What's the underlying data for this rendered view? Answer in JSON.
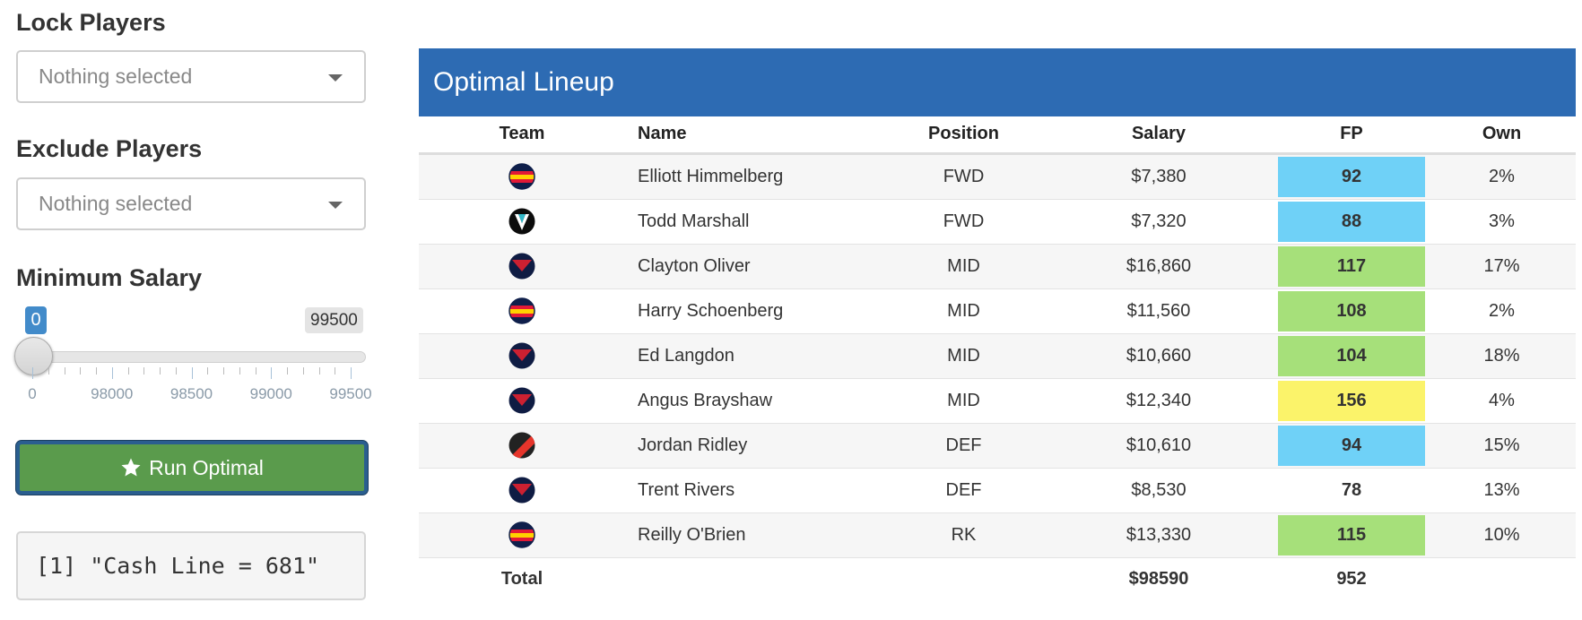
{
  "sidebar": {
    "lock_label": "Lock Players",
    "lock_placeholder": "Nothing selected",
    "exclude_label": "Exclude Players",
    "exclude_placeholder": "Nothing selected",
    "salary_label": "Minimum Salary",
    "slider": {
      "value_label": "0",
      "max_label": "99500",
      "ticks": [
        "0",
        "98000",
        "98500",
        "99000",
        "99500"
      ]
    },
    "run_button_label": "Run Optimal",
    "console_output": "[1] \"Cash Line = 681\""
  },
  "lineup": {
    "title": "Optimal Lineup",
    "columns": [
      "Team",
      "Name",
      "Position",
      "Salary",
      "FP",
      "Own"
    ],
    "rows": [
      {
        "team_logo": "adelaide-logo",
        "name": "Elliott Himmelberg",
        "position": "FWD",
        "salary": "$7,380",
        "fp": "92",
        "fp_color": "#6fd1f7",
        "own": "2%"
      },
      {
        "team_logo": "gws-logo",
        "name": "Todd Marshall",
        "position": "FWD",
        "salary": "$7,320",
        "fp": "88",
        "fp_color": "#6fd1f7",
        "own": "3%"
      },
      {
        "team_logo": "melbourne-logo",
        "name": "Clayton Oliver",
        "position": "MID",
        "salary": "$16,860",
        "fp": "117",
        "fp_color": "#a6e07a",
        "own": "17%"
      },
      {
        "team_logo": "adelaide-logo",
        "name": "Harry Schoenberg",
        "position": "MID",
        "salary": "$11,560",
        "fp": "108",
        "fp_color": "#a6e07a",
        "own": "2%"
      },
      {
        "team_logo": "melbourne-logo",
        "name": "Ed Langdon",
        "position": "MID",
        "salary": "$10,660",
        "fp": "104",
        "fp_color": "#a6e07a",
        "own": "18%"
      },
      {
        "team_logo": "melbourne-logo",
        "name": "Angus Brayshaw",
        "position": "MID",
        "salary": "$12,340",
        "fp": "156",
        "fp_color": "#fbf36a",
        "own": "4%"
      },
      {
        "team_logo": "essendon-logo",
        "name": "Jordan Ridley",
        "position": "DEF",
        "salary": "$10,610",
        "fp": "94",
        "fp_color": "#6fd1f7",
        "own": "15%"
      },
      {
        "team_logo": "melbourne-logo",
        "name": "Trent Rivers",
        "position": "DEF",
        "salary": "$8,530",
        "fp": "78",
        "fp_color": "",
        "own": "13%"
      },
      {
        "team_logo": "adelaide-logo",
        "name": "Reilly O'Brien",
        "position": "RK",
        "salary": "$13,330",
        "fp": "115",
        "fp_color": "#a6e07a",
        "own": "10%"
      }
    ],
    "total": {
      "label": "Total",
      "salary": "$98590",
      "fp": "952"
    }
  },
  "colors": {
    "header_blue": "#2d6bb3",
    "run_green": "#5a9b4c",
    "slider_badge_blue": "#428bca"
  }
}
